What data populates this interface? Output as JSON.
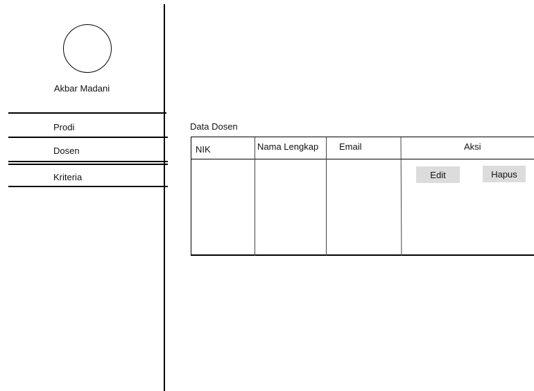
{
  "sidebar": {
    "user_name": "Akbar Madani",
    "items": [
      {
        "label": "Prodi"
      },
      {
        "label": "Dosen"
      },
      {
        "label": "Kriteria"
      }
    ]
  },
  "main": {
    "section_title": "Data Dosen",
    "table": {
      "columns": [
        "NIK",
        "Nama Lengkap",
        "Email",
        "Aksi"
      ],
      "actions": {
        "edit_label": "Edit",
        "delete_label": "Hapus"
      }
    }
  }
}
